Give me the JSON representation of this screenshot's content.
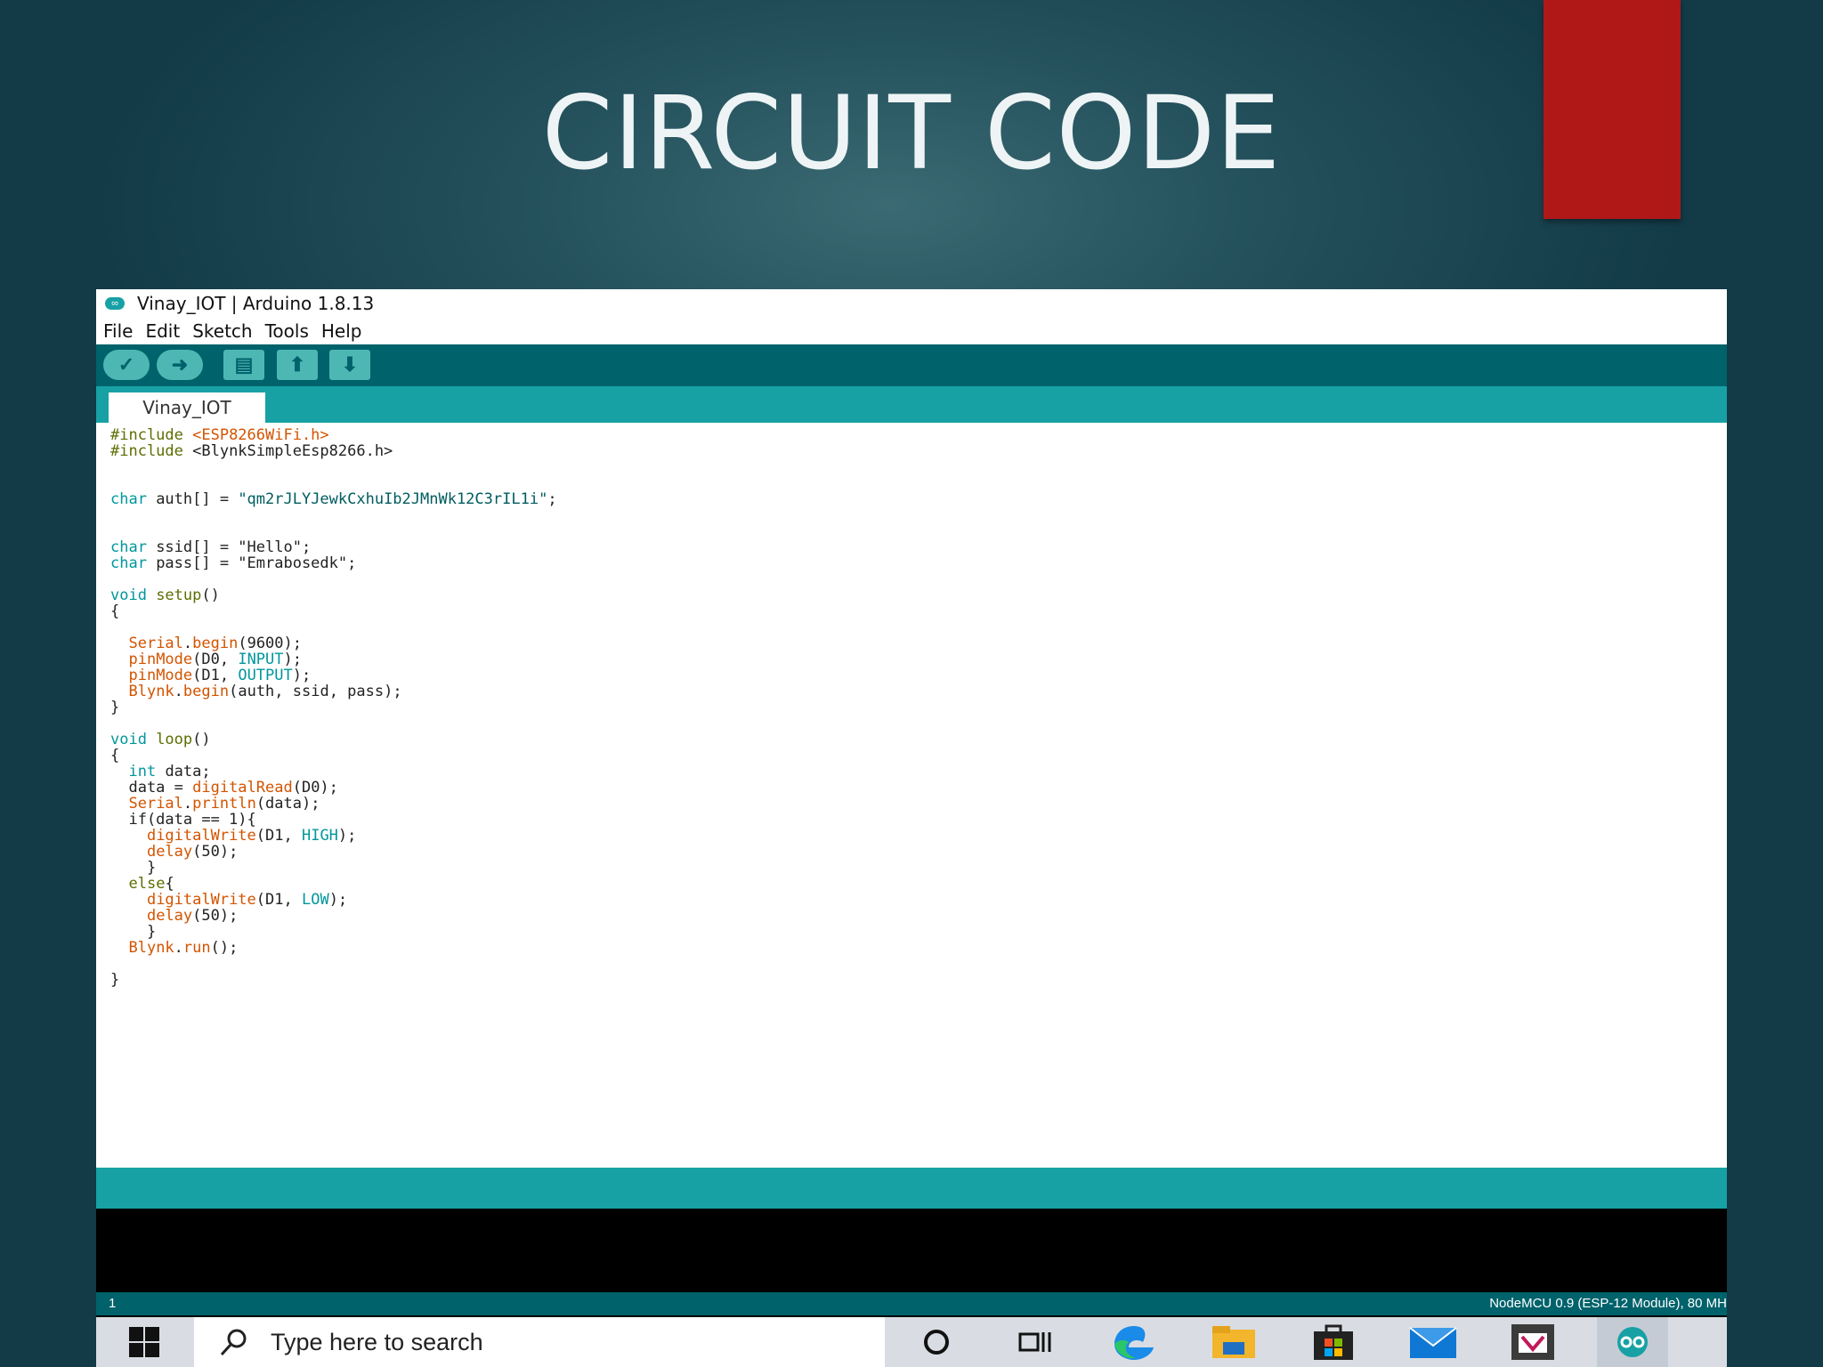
{
  "slide": {
    "title": "CIRCUIT CODE"
  },
  "window": {
    "title": "Vinay_IOT | Arduino 1.8.13"
  },
  "menu": [
    "File",
    "Edit",
    "Sketch",
    "Tools",
    "Help"
  ],
  "tab": {
    "label": "Vinay_IOT"
  },
  "code": [
    [
      {
        "t": "#include ",
        "c": "#5e6d03"
      },
      {
        "t": "<ESP8266WiFi.h>",
        "c": "#d35400"
      }
    ],
    [
      {
        "t": "#include ",
        "c": "#5e6d03"
      },
      {
        "t": "<BlynkSimpleEsp8266.h>",
        "c": "#222222"
      }
    ],
    [],
    [
      {
        "t": "char ",
        "c": "#00979c"
      },
      {
        "t": "auth[] = ",
        "c": "#222222"
      },
      {
        "t": "\"qm2rJLYJewkCxhuIb2JMnWk12C3rIL1i\"",
        "c": "#005c5f"
      },
      {
        "t": ";",
        "c": "#222222"
      }
    ],
    [],
    [
      {
        "t": "char ",
        "c": "#00979c"
      },
      {
        "t": "ssid[] = \"Hello\";",
        "c": "#222222"
      }
    ],
    [
      {
        "t": "char ",
        "c": "#00979c"
      },
      {
        "t": "pass[] = \"Emrabosedk\";",
        "c": "#222222"
      }
    ],
    [
      {
        "t": "void ",
        "c": "#00979c"
      },
      {
        "t": "setup",
        "c": "#5e6d03"
      },
      {
        "t": "()",
        "c": "#222222"
      }
    ],
    [
      {
        "t": "{",
        "c": "#222222"
      }
    ],
    [],
    [
      {
        "t": "  "
      },
      {
        "t": "Serial",
        "c": "#d35400"
      },
      {
        "t": ".",
        "c": "#222222"
      },
      {
        "t": "begin",
        "c": "#d35400"
      },
      {
        "t": "(9600);",
        "c": "#222222"
      }
    ],
    [
      {
        "t": "  "
      },
      {
        "t": "pinMode",
        "c": "#d35400"
      },
      {
        "t": "(D0, ",
        "c": "#222222"
      },
      {
        "t": "INPUT",
        "c": "#00979c"
      },
      {
        "t": ");",
        "c": "#222222"
      }
    ],
    [
      {
        "t": "  "
      },
      {
        "t": "pinMode",
        "c": "#d35400"
      },
      {
        "t": "(D1, ",
        "c": "#222222"
      },
      {
        "t": "OUTPUT",
        "c": "#00979c"
      },
      {
        "t": ");",
        "c": "#222222"
      }
    ],
    [
      {
        "t": "  "
      },
      {
        "t": "Blynk",
        "c": "#d35400"
      },
      {
        "t": ".",
        "c": "#222222"
      },
      {
        "t": "begin",
        "c": "#d35400"
      },
      {
        "t": "(auth, ssid, pass);",
        "c": "#222222"
      }
    ],
    [
      {
        "t": "}",
        "c": "#222222"
      }
    ],
    [],
    [
      {
        "t": "void ",
        "c": "#00979c"
      },
      {
        "t": "loop",
        "c": "#5e6d03"
      },
      {
        "t": "()",
        "c": "#222222"
      }
    ],
    [
      {
        "t": "{",
        "c": "#222222"
      }
    ],
    [
      {
        "t": "  "
      },
      {
        "t": "int ",
        "c": "#00979c"
      },
      {
        "t": "data;",
        "c": "#222222"
      }
    ],
    [
      {
        "t": "  data = ",
        "c": "#222222"
      },
      {
        "t": "digitalRead",
        "c": "#d35400"
      },
      {
        "t": "(D0);",
        "c": "#222222"
      }
    ],
    [
      {
        "t": "  "
      },
      {
        "t": "Serial",
        "c": "#d35400"
      },
      {
        "t": ".",
        "c": "#222222"
      },
      {
        "t": "println",
        "c": "#d35400"
      },
      {
        "t": "(data);",
        "c": "#222222"
      }
    ],
    [
      {
        "t": "  if(data == 1){",
        "c": "#222222"
      }
    ],
    [
      {
        "t": "    "
      },
      {
        "t": "digitalWrite",
        "c": "#d35400"
      },
      {
        "t": "(D1, ",
        "c": "#222222"
      },
      {
        "t": "HIGH",
        "c": "#00979c"
      },
      {
        "t": ");",
        "c": "#222222"
      }
    ],
    [
      {
        "t": "    "
      },
      {
        "t": "delay",
        "c": "#d35400"
      },
      {
        "t": "(50);",
        "c": "#222222"
      }
    ],
    [
      {
        "t": "    }",
        "c": "#222222"
      }
    ],
    [
      {
        "t": "  "
      },
      {
        "t": "else",
        "c": "#5e6d03"
      },
      {
        "t": "{",
        "c": "#222222"
      }
    ],
    [
      {
        "t": "    "
      },
      {
        "t": "digitalWrite",
        "c": "#d35400"
      },
      {
        "t": "(D1, ",
        "c": "#222222"
      },
      {
        "t": "LOW",
        "c": "#00979c"
      },
      {
        "t": ");",
        "c": "#222222"
      }
    ],
    [
      {
        "t": "    "
      },
      {
        "t": "delay",
        "c": "#d35400"
      },
      {
        "t": "(50);",
        "c": "#222222"
      }
    ],
    [
      {
        "t": "    }",
        "c": "#222222"
      }
    ],
    [
      {
        "t": "  "
      },
      {
        "t": "Blynk",
        "c": "#d35400"
      },
      {
        "t": ".",
        "c": "#222222"
      },
      {
        "t": "run",
        "c": "#d35400"
      },
      {
        "t": "();",
        "c": "#222222"
      }
    ],
    [],
    [
      {
        "t": "}",
        "c": "#222222"
      }
    ]
  ],
  "status": {
    "line": "1",
    "board": "NodeMCU 0.9 (ESP-12 Module), 80 MH"
  },
  "taskbar": {
    "search_placeholder": "Type here to search"
  },
  "icons": {
    "toolbar": [
      "verify-icon",
      "upload-icon",
      "new-icon",
      "open-icon",
      "save-icon"
    ],
    "taskbar": [
      "windows-start-icon",
      "search-icon",
      "cortana-icon",
      "task-view-icon",
      "edge-icon",
      "file-explorer-icon",
      "store-icon",
      "mail-icon",
      "app-icon",
      "arduino-icon"
    ]
  },
  "colors": {
    "arduino_teal": "#17a1a5",
    "arduino_dark_teal": "#00626b",
    "accent_red": "#b01818",
    "keyword": "#00979c",
    "function": "#d35400",
    "preprocessor": "#5e6d03"
  }
}
